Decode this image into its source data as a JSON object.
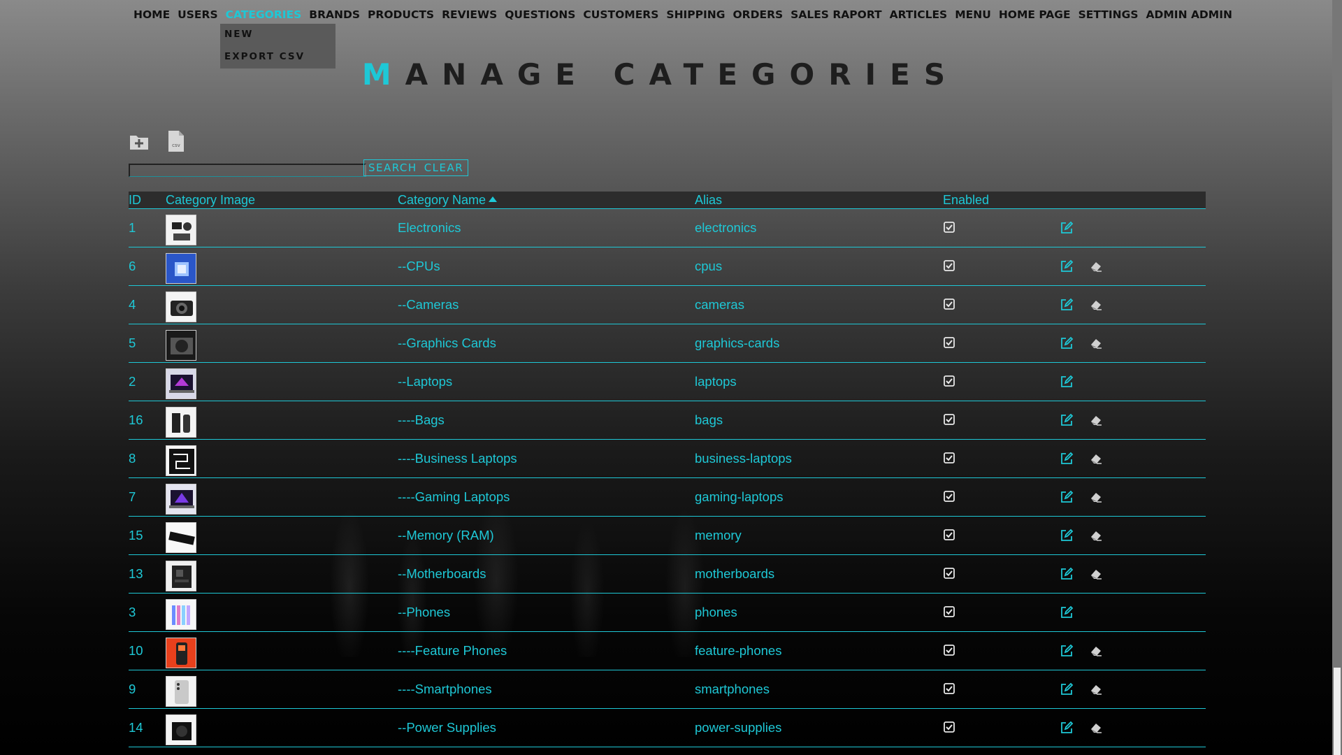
{
  "nav": {
    "items": [
      "HOME",
      "USERS",
      "CATEGORIES",
      "BRANDS",
      "PRODUCTS",
      "REVIEWS",
      "QUESTIONS",
      "CUSTOMERS",
      "SHIPPING",
      "ORDERS",
      "SALES RAPORT",
      "ARTICLES",
      "MENU",
      "HOME PAGE",
      "SETTINGS",
      "ADMIN ADMIN"
    ],
    "active": "CATEGORIES",
    "dropdown": [
      "NEW",
      "EXPORT CSV"
    ]
  },
  "page": {
    "title_first": "M",
    "title_rest": "ANAGE CATEGORIES"
  },
  "toolbar": {
    "new_icon": "folder-plus-icon",
    "csv_icon": "file-csv-icon",
    "csv_label": "csv"
  },
  "search": {
    "value": "",
    "search_label": "SEARCH",
    "clear_label": "CLEAR"
  },
  "table": {
    "headers": {
      "id": "ID",
      "image": "Category Image",
      "name": "Category Name",
      "alias": "Alias",
      "enabled": "Enabled"
    },
    "sort": {
      "column": "Category Name",
      "direction": "asc"
    },
    "rows": [
      {
        "id": "1",
        "name": "Electronics",
        "alias": "electronics",
        "enabled": true,
        "deletable": false,
        "thumb": "electronics"
      },
      {
        "id": "6",
        "name": "--CPUs",
        "alias": "cpus",
        "enabled": true,
        "deletable": true,
        "thumb": "cpu"
      },
      {
        "id": "4",
        "name": "--Cameras",
        "alias": "cameras",
        "enabled": true,
        "deletable": true,
        "thumb": "camera"
      },
      {
        "id": "5",
        "name": "--Graphics Cards",
        "alias": "graphics-cards",
        "enabled": true,
        "deletable": true,
        "thumb": "gpu"
      },
      {
        "id": "2",
        "name": "--Laptops",
        "alias": "laptops",
        "enabled": true,
        "deletable": false,
        "thumb": "laptop"
      },
      {
        "id": "16",
        "name": "----Bags",
        "alias": "bags",
        "enabled": true,
        "deletable": true,
        "thumb": "bags"
      },
      {
        "id": "8",
        "name": "----Business Laptops",
        "alias": "business-laptops",
        "enabled": true,
        "deletable": true,
        "thumb": "business"
      },
      {
        "id": "7",
        "name": "----Gaming Laptops",
        "alias": "gaming-laptops",
        "enabled": true,
        "deletable": true,
        "thumb": "gaming"
      },
      {
        "id": "15",
        "name": "--Memory (RAM)",
        "alias": "memory",
        "enabled": true,
        "deletable": true,
        "thumb": "ram"
      },
      {
        "id": "13",
        "name": "--Motherboards",
        "alias": "motherboards",
        "enabled": true,
        "deletable": true,
        "thumb": "motherboard"
      },
      {
        "id": "3",
        "name": "--Phones",
        "alias": "phones",
        "enabled": true,
        "deletable": false,
        "thumb": "phones"
      },
      {
        "id": "10",
        "name": "----Feature Phones",
        "alias": "feature-phones",
        "enabled": true,
        "deletable": true,
        "thumb": "feature"
      },
      {
        "id": "9",
        "name": "----Smartphones",
        "alias": "smartphones",
        "enabled": true,
        "deletable": true,
        "thumb": "smartphone"
      },
      {
        "id": "14",
        "name": "--Power Supplies",
        "alias": "power-supplies",
        "enabled": true,
        "deletable": true,
        "thumb": "psu"
      }
    ]
  },
  "colors": {
    "accent": "#1ec8d6",
    "nav_text": "#111111",
    "header_bg": "#2c2c2c"
  }
}
